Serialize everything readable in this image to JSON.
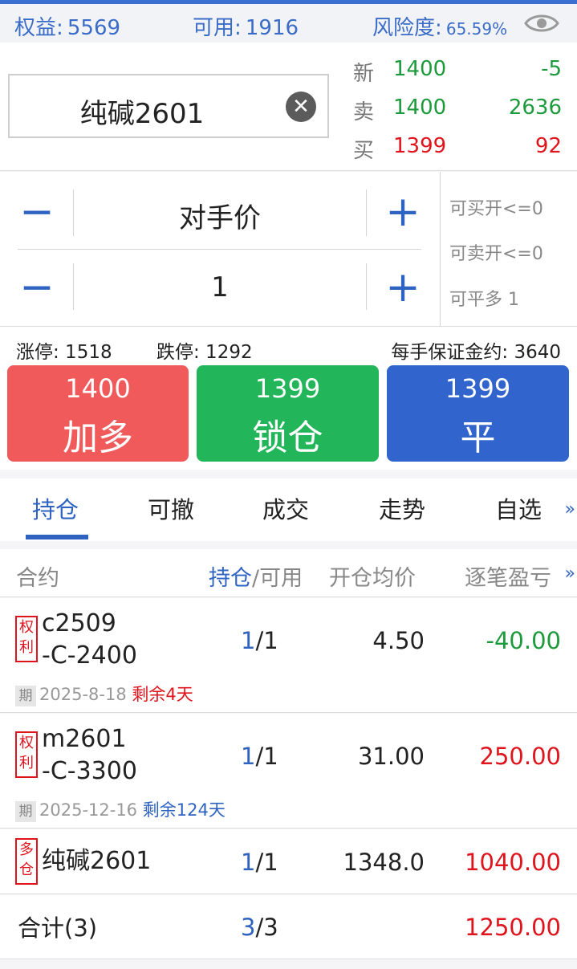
{
  "account": {
    "equity_label": "权益:",
    "equity": "5569",
    "available_label": "可用:",
    "available": "1916",
    "risk_label": "风险度:",
    "risk": "65.59%"
  },
  "quote": {
    "symbol": "纯碱2601",
    "clear_glyph": "✕",
    "last_label": "新",
    "last_price": "1400",
    "last_change": "-5",
    "ask_label": "卖",
    "ask_price": "1400",
    "ask_qty": "2636",
    "bid_label": "买",
    "bid_price": "1399",
    "bid_qty": "92"
  },
  "order": {
    "price_type": "对手价",
    "quantity": "1",
    "minus_glyph": "−",
    "plus_glyph": "+",
    "can_buy_open": "可买开<=0",
    "can_sell_open": "可卖开<=0",
    "can_close_long": "可平多 1"
  },
  "limits": {
    "limit_up": "涨停: 1518",
    "limit_down": "跌停: 1292",
    "margin_per_lot": "每手保证金约: 3640"
  },
  "actions": [
    {
      "price": "1400",
      "label": "加多",
      "color": "#f05a5a"
    },
    {
      "price": "1399",
      "label": "锁仓",
      "color": "#23b55a"
    },
    {
      "price": "1399",
      "label": "平",
      "color": "#3164cc"
    }
  ],
  "tabs": [
    "持仓",
    "可撤",
    "成交",
    "走势",
    "自选"
  ],
  "tabs_more": "»",
  "table": {
    "col_contract": "合约",
    "col_position_a": "持仓",
    "col_position_b": "/可用",
    "col_avg_price": "开仓均价",
    "col_pnl": "逐笔盈亏",
    "col_more": "»"
  },
  "positions": [
    {
      "tag_top": "权",
      "tag_bottom": "利",
      "line1": "c2509",
      "line2": "-C-2400",
      "held": "1",
      "avail": "/1",
      "avg": "4.50",
      "pnl": "-40.00",
      "expiry_tag": "期",
      "expiry": "2025-8-18",
      "remaining": "剩余4天"
    },
    {
      "tag_top": "权",
      "tag_bottom": "利",
      "line1": "m2601",
      "line2": "-C-3300",
      "held": "1",
      "avail": "/1",
      "avg": "31.00",
      "pnl": "250.00",
      "expiry_tag": "期",
      "expiry": "2025-12-16",
      "remaining": "剩余124天"
    },
    {
      "tag_top": "多",
      "tag_bottom": "仓",
      "line1": "纯碱2601",
      "held": "1",
      "avail": "/1",
      "avg": "1348.0",
      "pnl": "1040.00"
    }
  ],
  "total": {
    "label": "合计(3)",
    "held": "3",
    "avail": "/3",
    "pnl": "1250.00"
  }
}
